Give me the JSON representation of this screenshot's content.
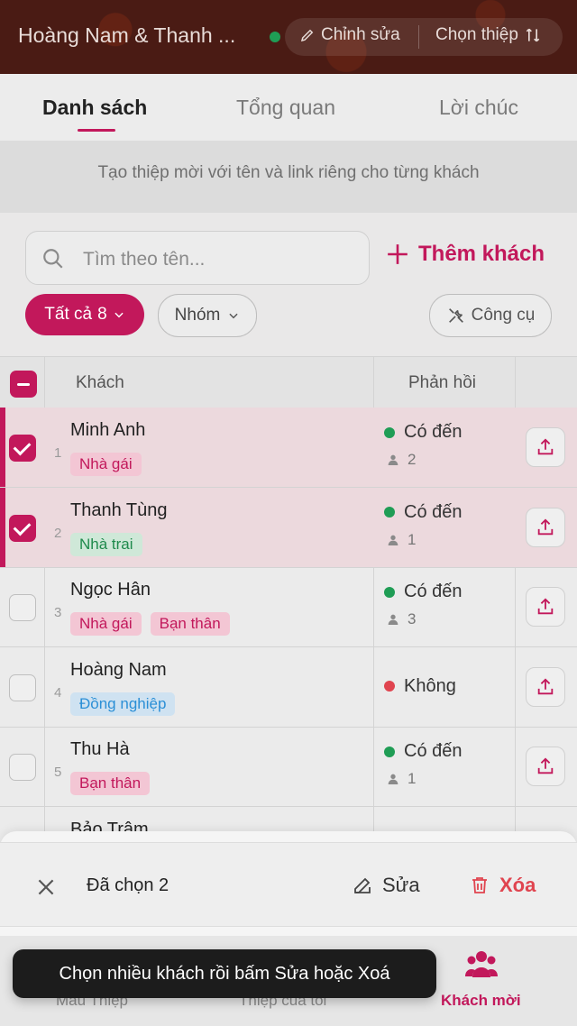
{
  "header": {
    "title": "Hoàng Nam & Thanh ...",
    "edit_label": "Chỉnh sửa",
    "choose_label": "Chọn thiệp"
  },
  "tabs": [
    {
      "label": "Danh sách",
      "active": true
    },
    {
      "label": "Tổng quan",
      "active": false
    },
    {
      "label": "Lời chúc",
      "active": false
    }
  ],
  "hint": "Tạo thiệp mời với tên và link riêng cho từng khách",
  "search": {
    "placeholder": "Tìm theo tên..."
  },
  "add_guest_label": "Thêm khách",
  "filters": {
    "all_label": "Tất cả",
    "all_count": "8",
    "group_label": "Nhóm",
    "tools_label": "Công cụ"
  },
  "table": {
    "col_guest": "Khách",
    "col_response": "Phản hồi",
    "rows": [
      {
        "num": "1",
        "name": "Minh Anh",
        "tags": [
          {
            "text": "Nhà gái",
            "kind": "pink"
          }
        ],
        "status": "Có đến",
        "status_color": "#1f9d55",
        "count": "2",
        "selected": true
      },
      {
        "num": "2",
        "name": "Thanh Tùng",
        "tags": [
          {
            "text": "Nhà trai",
            "kind": "green"
          }
        ],
        "status": "Có đến",
        "status_color": "#1f9d55",
        "count": "1",
        "selected": true
      },
      {
        "num": "3",
        "name": "Ngọc Hân",
        "tags": [
          {
            "text": "Nhà gái",
            "kind": "pink"
          },
          {
            "text": "Bạn thân",
            "kind": "pink"
          }
        ],
        "status": "Có đến",
        "status_color": "#1f9d55",
        "count": "3",
        "selected": false
      },
      {
        "num": "4",
        "name": "Hoàng Nam",
        "tags": [
          {
            "text": "Đồng nghiệp",
            "kind": "blue"
          }
        ],
        "status": "Không",
        "status_color": "#e0444f",
        "count": "",
        "selected": false
      },
      {
        "num": "5",
        "name": "Thu Hà",
        "tags": [
          {
            "text": "Bạn thân",
            "kind": "pink"
          }
        ],
        "status": "Có đến",
        "status_color": "#1f9d55",
        "count": "1",
        "selected": false
      },
      {
        "num": "",
        "name": "Bảo Trâm",
        "tags": [],
        "status": "",
        "status_color": "#1f9d55",
        "count": "",
        "selected": false
      }
    ]
  },
  "action_sheet": {
    "selected_text": "Đã chọn 2",
    "edit_label": "Sửa",
    "delete_label": "Xóa"
  },
  "bottom_nav": [
    {
      "label": "Mẫu Thiệp"
    },
    {
      "label": "Thiệp của tôi"
    },
    {
      "label": "Khách mời"
    }
  ],
  "toast": "Chọn nhiều khách rồi bấm Sửa hoặc Xoá",
  "colors": {
    "accent": "#c2185b",
    "green": "#1f9d55",
    "red": "#e0444f"
  }
}
